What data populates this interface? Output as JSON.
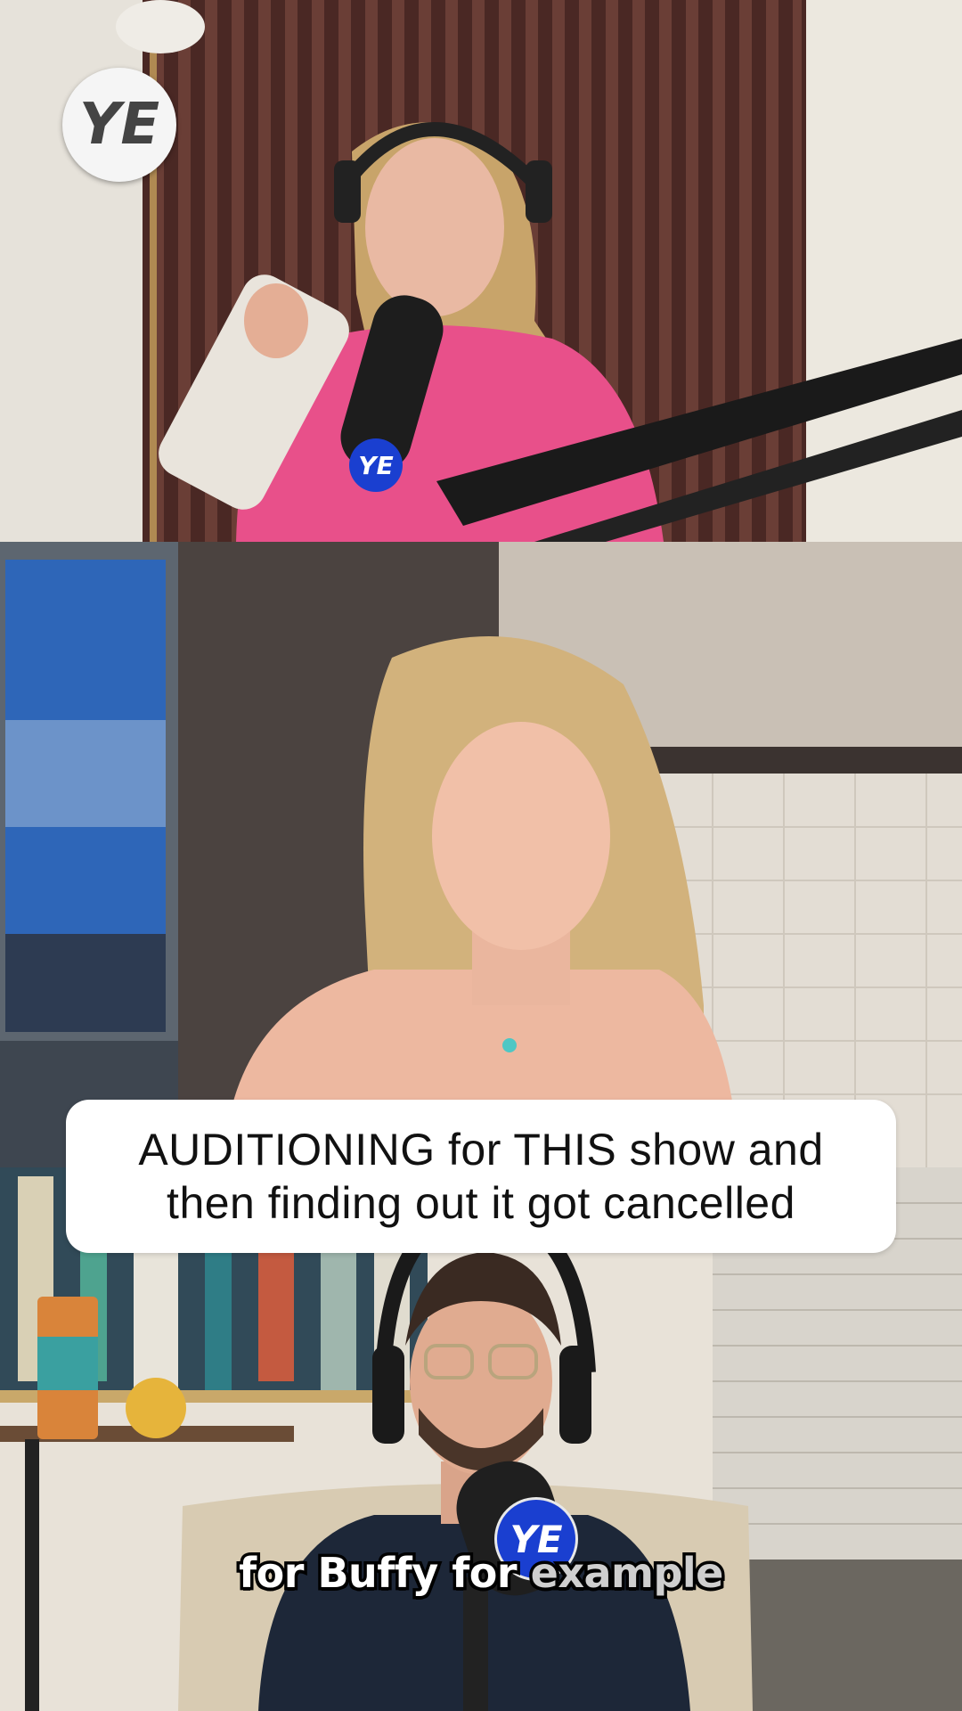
{
  "caption": {
    "line1": "AUDITIONING for THIS show and",
    "line2": "then finding out it got cancelled"
  },
  "subtitle": {
    "words": [
      "for",
      "Buffy",
      "for",
      "example"
    ],
    "highlight_index": 3
  },
  "logos": {
    "text": "YE"
  },
  "colors": {
    "sweater": "#e8508a",
    "accent_logo": "#1a3fd0",
    "caption_bg": "#ffffff"
  }
}
